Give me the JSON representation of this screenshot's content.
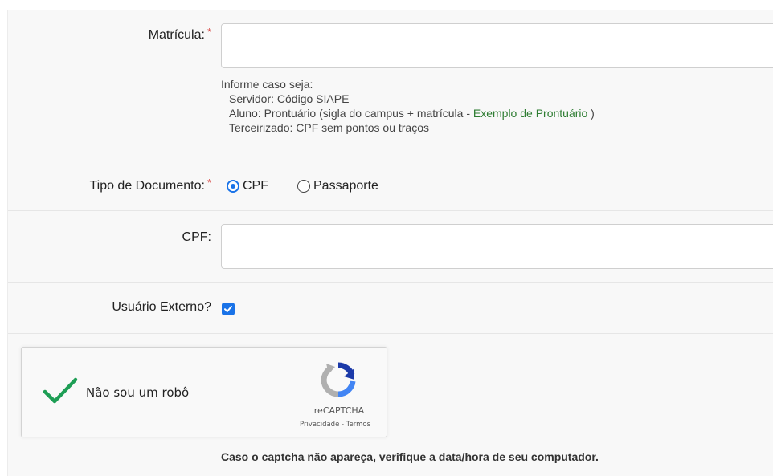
{
  "form": {
    "matricula": {
      "label": "Matrícula:",
      "required_mark": "*",
      "value": "",
      "help": {
        "intro": "Informe caso seja:",
        "servidor": "Servidor: Código SIAPE",
        "aluno_prefix": "Aluno: Prontuário (sigla do campus + matrícula - ",
        "aluno_link": "Exemplo de Prontuário",
        "aluno_suffix": " )",
        "terceirizado": "Terceirizado: CPF sem pontos ou traços"
      }
    },
    "tipo_documento": {
      "label": "Tipo de Documento:",
      "required_mark": "*",
      "options": [
        {
          "label": "CPF",
          "checked": true
        },
        {
          "label": "Passaporte",
          "checked": false
        }
      ]
    },
    "cpf": {
      "label": "CPF:",
      "value": ""
    },
    "usuario_externo": {
      "label": "Usuário Externo?",
      "checked": true
    }
  },
  "recaptcha": {
    "label": "Não sou um robô",
    "brand": "reCAPTCHA",
    "privacy": "Privacidade",
    "separator": " - ",
    "terms": "Termos",
    "verified": true
  },
  "notice": "Caso o captcha não apareça, verifique a data/hora de seu computador.",
  "colors": {
    "accent": "#1a73e8",
    "required": "#d9534f",
    "link": "#2e7d32",
    "check": "#1e9e55"
  }
}
